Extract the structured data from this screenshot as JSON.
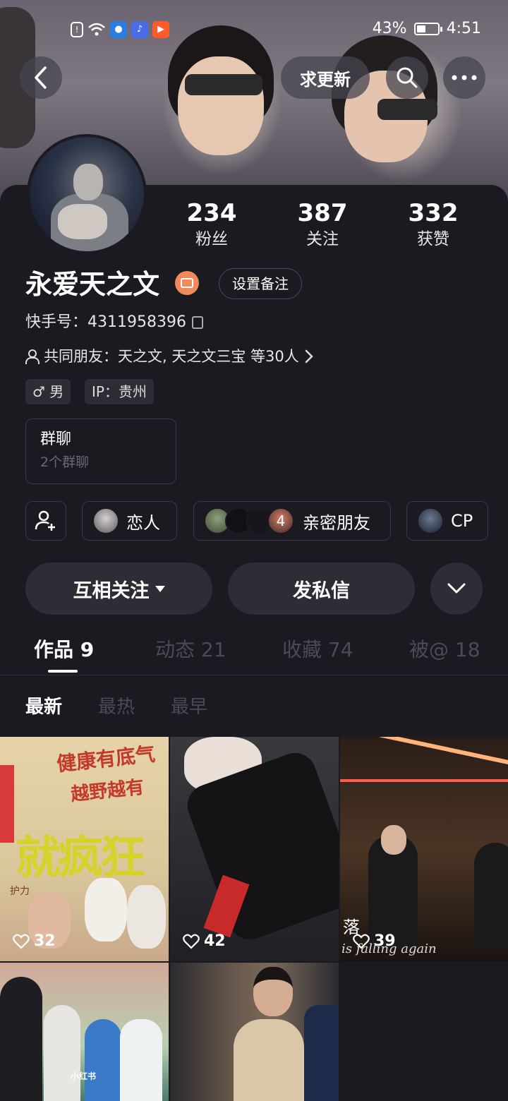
{
  "status_bar": {
    "battery": "43%",
    "time": "4:51"
  },
  "header": {
    "update_label": "求更新"
  },
  "profile": {
    "name": "永爱天之文",
    "remark_label": "设置备注",
    "kuaishou_id": "快手号：4311958396",
    "mutual_friends": "共同朋友：天之文, 天之文三宝 等30人",
    "gender": "♂ 男",
    "ip": "IP：贵州"
  },
  "stats": [
    {
      "value": "234",
      "label": "粉丝"
    },
    {
      "value": "387",
      "label": "关注"
    },
    {
      "value": "332",
      "label": "获赞"
    }
  ],
  "group_chat": {
    "title": "群聊",
    "subtitle": "2个群聊"
  },
  "relations": [
    {
      "label": "恋人"
    },
    {
      "count": "4",
      "label": "亲密朋友"
    },
    {
      "label": "CP"
    }
  ],
  "actions": {
    "follow_label": "互相关注",
    "message_label": "发私信"
  },
  "tabs": [
    "作品 9",
    "动态 21",
    "收藏 74",
    "被@ 18"
  ],
  "sort_options": [
    "最新",
    "最热",
    "最早"
  ],
  "videos": [
    {
      "likes": "32",
      "overlay_text": "就疯狂",
      "banner_text": "健康有底气",
      "banner_text2": "越野越有",
      "sub_text": "护力"
    },
    {
      "likes": "42"
    },
    {
      "likes": "39",
      "overlay_text": "落",
      "caption": "is falling again"
    },
    {
      "likes": "",
      "watermark": "小红书"
    },
    {
      "likes": ""
    }
  ]
}
